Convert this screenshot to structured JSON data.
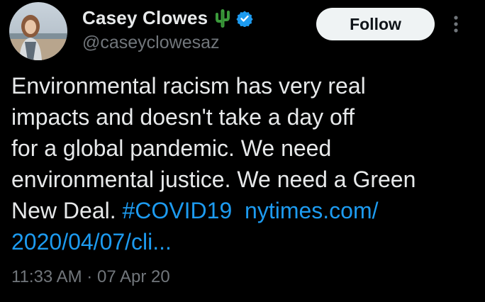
{
  "author": {
    "display_name": "Casey Clowes",
    "handle": "@caseyclowesaz",
    "name_emoji": "cactus-icon",
    "verified_badge": "verified-icon"
  },
  "follow_button": {
    "label": "Follow"
  },
  "more_menu": {
    "icon": "more-vertical-icon"
  },
  "tweet": {
    "line1": "Environmental racism has very real",
    "line2": "impacts and doesn't take a day off",
    "line3": "for a global pandemic. We need",
    "line4": "environmental justice. We need a Green",
    "line5_text": "New Deal. ",
    "hashtag": "#COVID19",
    "url_part1": "nytimes.com/",
    "url_part2": "2020/04/07/cli..."
  },
  "meta": {
    "time": "11:33 AM",
    "separator": "·",
    "date": "07 Apr 20"
  },
  "colors": {
    "background": "#000000",
    "text": "#e7e9ea",
    "secondary": "#71767b",
    "link": "#1d9bf0",
    "verified": "#1d9bf0",
    "follow_bg": "#eff3f4"
  }
}
